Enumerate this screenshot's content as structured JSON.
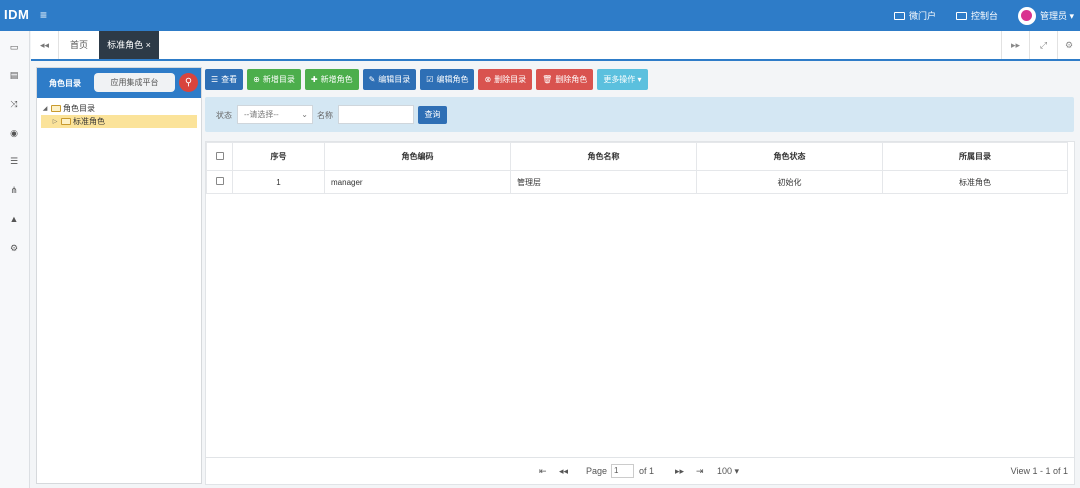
{
  "header": {
    "logo": "IDM",
    "menu_icon": "≡",
    "nav": {
      "portal": "微门户",
      "console": "控制台",
      "user": "管理员 ▾"
    }
  },
  "tabs": {
    "back_icon": "◂◂",
    "home": "首页",
    "active": "标准角色 ×",
    "forward_icon": "▸▸",
    "fullscreen_icon": "⤢",
    "settings_icon": "⚙"
  },
  "left_panel": {
    "title": "角色目录",
    "search_value": "应用集成平台",
    "search_icon": "⚲",
    "tree": [
      {
        "label": "角色目录"
      },
      {
        "label": "标准角色"
      }
    ]
  },
  "toolbar": [
    {
      "label": "查看",
      "glyph": "☰",
      "color": "#2e6fb5"
    },
    {
      "label": "新增目录",
      "glyph": "⊕",
      "color": "#4cae4c"
    },
    {
      "label": "新增角色",
      "glyph": "✚",
      "color": "#4cae4c"
    },
    {
      "label": "编辑目录",
      "glyph": "✎",
      "color": "#2e6fb5"
    },
    {
      "label": "编辑角色",
      "glyph": "☑",
      "color": "#2e6fb5"
    },
    {
      "label": "删除目录",
      "glyph": "⊗",
      "color": "#d9534f"
    },
    {
      "label": "删除角色",
      "glyph": "🗑",
      "color": "#d9534f"
    },
    {
      "label": "更多操作",
      "glyph": "",
      "color": "#5bc0de"
    }
  ],
  "filter": {
    "status_label": "状态",
    "status_placeholder": "--请选择--",
    "name_label": "名称",
    "query_button": "查询"
  },
  "table": {
    "columns": [
      "序号",
      "角色编码",
      "角色名称",
      "角色状态",
      "所属目录"
    ],
    "rows": [
      [
        "1",
        "manager",
        "管理层",
        "初始化",
        "标准角色"
      ]
    ]
  },
  "pager": {
    "page_label": "Page",
    "page_value": "1",
    "of_label": "of 1",
    "page_size": "100 ▾",
    "view_text": "View 1 - 1 of 1"
  }
}
